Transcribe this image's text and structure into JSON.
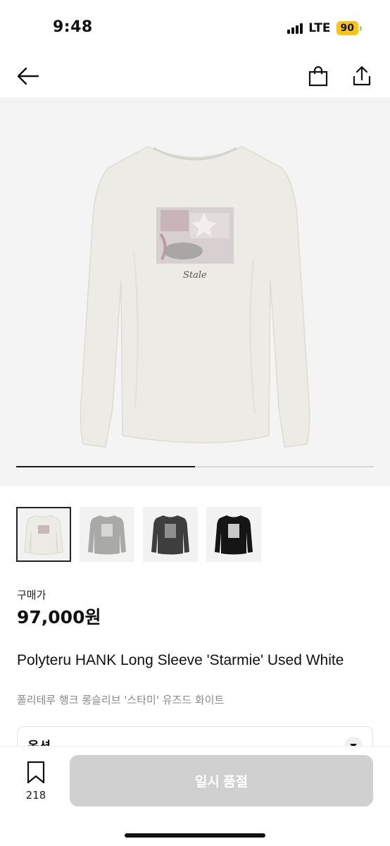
{
  "status_bar": {
    "time": "9:48",
    "network": "LTE",
    "battery": "90",
    "battery_color": "#f5c518"
  },
  "nav": {
    "back_icon": "arrow-left-icon",
    "bag_icon": "shopping-bag-icon",
    "share_icon": "share-icon"
  },
  "gallery": {
    "progress_fraction": 0.5,
    "graphic_text": "Stale",
    "thumbnails": [
      {
        "color": "white",
        "selected": true
      },
      {
        "color": "gray",
        "selected": false
      },
      {
        "color": "charcoal",
        "selected": false
      },
      {
        "color": "black",
        "selected": false
      }
    ]
  },
  "price": {
    "label": "구매가",
    "value": "97,000원"
  },
  "product": {
    "name_en": "Polyteru HANK Long Sleeve 'Starmie' Used White",
    "name_ko": "폴리테루 행크 롱슬리브 '스타미' 유즈드 화이트"
  },
  "option": {
    "label": "옵션"
  },
  "bottom_bar": {
    "wish_count": "218",
    "soldout_label": "일시 품절"
  }
}
